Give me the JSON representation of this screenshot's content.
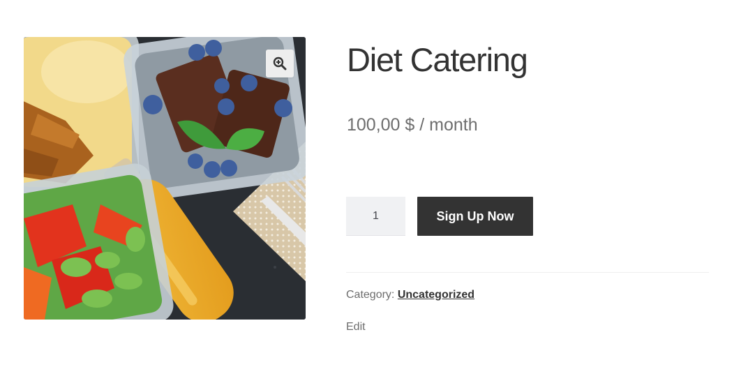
{
  "product": {
    "title": "Diet Catering",
    "price": "100,00 $ / month",
    "quantity": "1",
    "cta_label": "Sign Up Now",
    "category_label": "Category:",
    "category_value": "Uncategorized",
    "edit_label": "Edit"
  },
  "gallery": {
    "zoom_icon": "zoom-in-magnifier-icon",
    "image_subject": "meal-prep-containers-photo"
  },
  "colors": {
    "button_bg": "#333333",
    "button_text": "#ffffff",
    "quantity_bg": "#f0f1f3",
    "text": "#333333",
    "muted": "#6d6d6d"
  }
}
